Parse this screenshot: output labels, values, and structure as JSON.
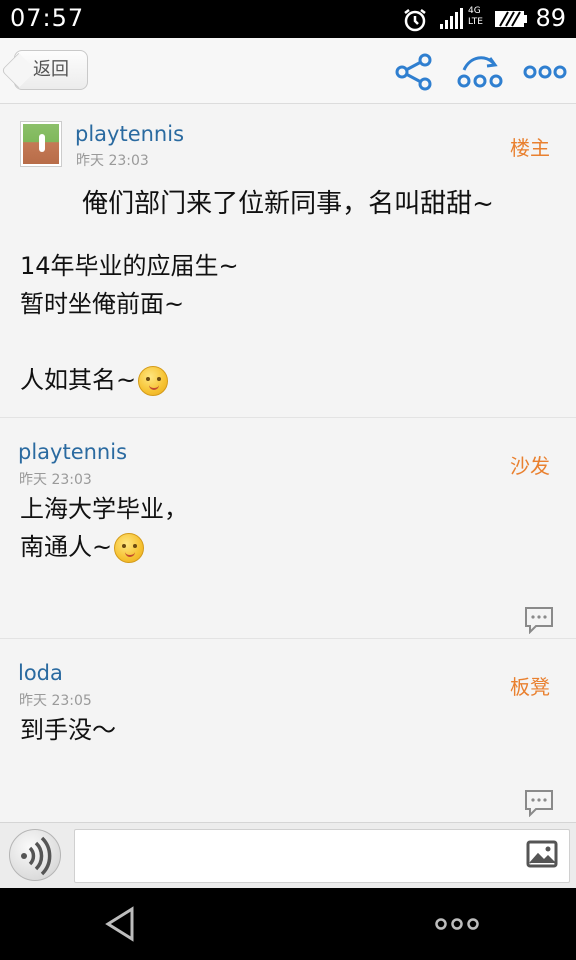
{
  "status_bar": {
    "time": "07:57",
    "network": "4G",
    "network_sub": "LTE",
    "battery": "89"
  },
  "header": {
    "back_label": "返回",
    "icons": [
      "share-icon",
      "redirect-icon",
      "more-icon"
    ]
  },
  "posts": [
    {
      "author": "playtennis",
      "time": "昨天 23:03",
      "floor": "楼主",
      "title": "俺们部门来了位新同事，名叫甜甜~",
      "lines": [
        "14年毕业的应届生~",
        "暂时坐俺前面~",
        "",
        "人如其名~"
      ]
    },
    {
      "author": "playtennis",
      "time": "昨天 23:03",
      "floor": "沙发",
      "lines": [
        "上海大学毕业，",
        "南通人~"
      ]
    },
    {
      "author": "loda",
      "time": "昨天 23:05",
      "floor": "板凳",
      "lines": [
        "到手没～"
      ]
    }
  ],
  "input_bar": {
    "placeholder": "",
    "icons": [
      "voice-icon",
      "image-icon"
    ]
  },
  "nav_bar": {
    "icons": [
      "back-triangle-icon",
      "menu-dots-icon"
    ]
  }
}
